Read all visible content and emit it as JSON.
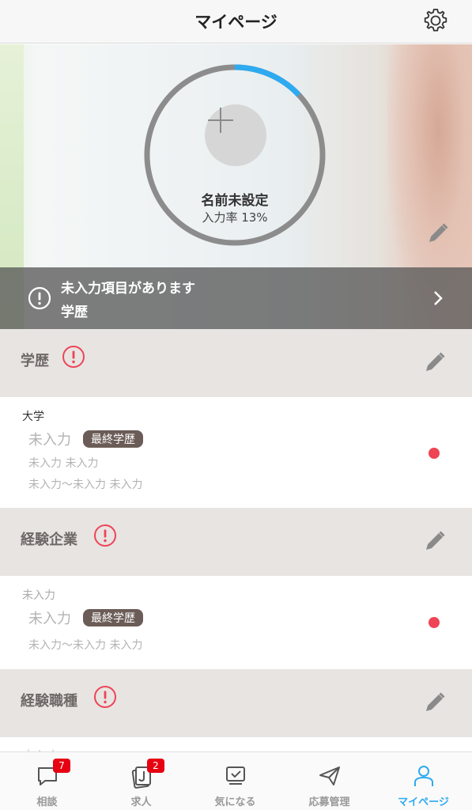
{
  "header": {
    "title": "マイページ",
    "settings_icon": "gear-icon"
  },
  "profile": {
    "name": "名前未設定",
    "rate_label": "入力率 13%",
    "progress": 0.13,
    "progress_color": "#2eaaf0",
    "track_color": "#8c8c8c"
  },
  "alert": {
    "line1": "未入力項目があります",
    "line2": "学歴"
  },
  "sections": {
    "education": {
      "title": "学歴",
      "type_label": "大学",
      "name": "未入力",
      "badge": "最終学歴",
      "line1": "未入力 未入力",
      "line2": "未入力〜未入力 未入力"
    },
    "company": {
      "title": "経験企業",
      "type_label": "未入力",
      "name": "未入力",
      "badge": "最終学歴",
      "line1": "未入力〜未入力 未入力"
    },
    "job": {
      "title": "経験職種",
      "peek": "未入力"
    }
  },
  "tabbar": {
    "items": [
      {
        "label": "相談",
        "badge": "7"
      },
      {
        "label": "求人",
        "badge": "2"
      },
      {
        "label": "気になる"
      },
      {
        "label": "応募管理"
      },
      {
        "label": "マイページ"
      }
    ],
    "active_color": "#2eaaf0",
    "badge_color": "#e60012"
  }
}
